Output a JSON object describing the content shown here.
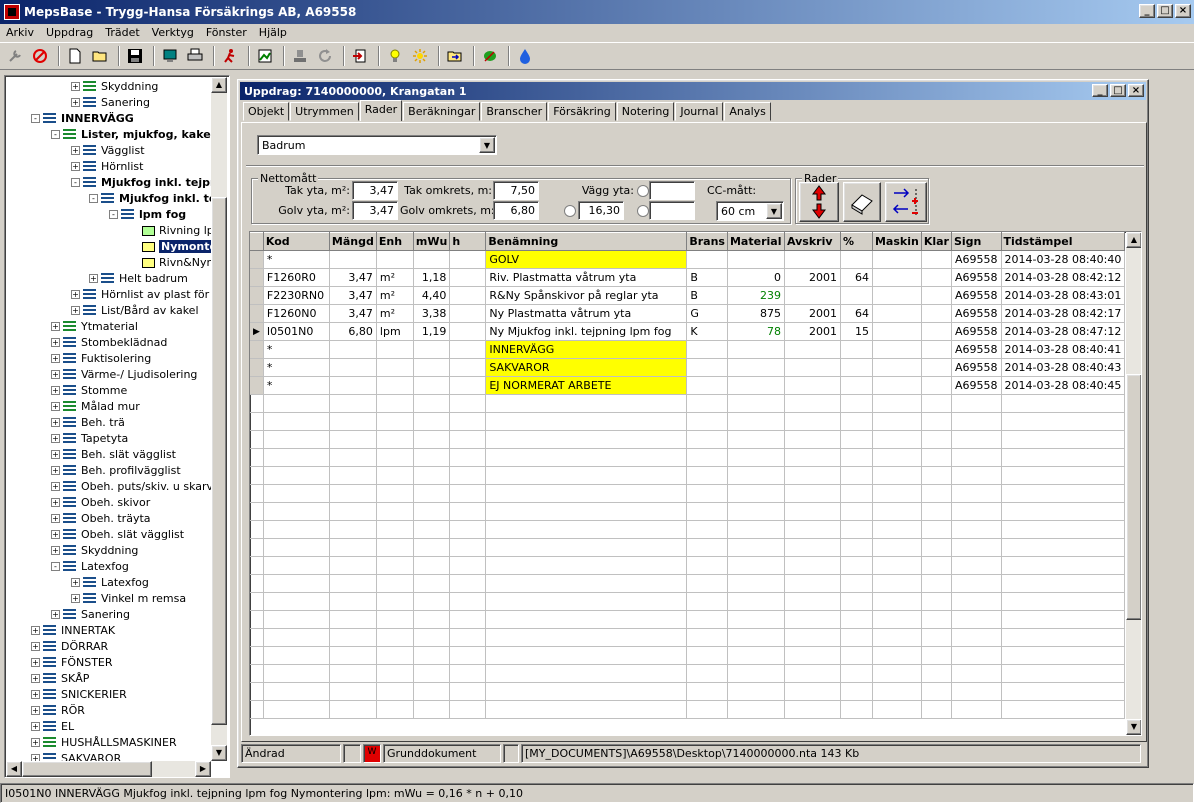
{
  "app": {
    "title": "MepsBase - Trygg-Hansa Försäkrings AB, A69558",
    "window_buttons": [
      "_",
      "□",
      "×"
    ]
  },
  "menu": [
    "Arkiv",
    "Uppdrag",
    "Trädet",
    "Verktyg",
    "Fönster",
    "Hjälp"
  ],
  "toolbar": {
    "icons": [
      "wrench-icon",
      "stop-icon",
      "new-document-icon",
      "open-folder-icon",
      "save-icon",
      "monitor-icon",
      "print-icon",
      "run-icon",
      "image-icon",
      "stamp-icon",
      "refresh-icon",
      "export-icon",
      "lightbulb-icon",
      "sun-icon",
      "folder-arrow-icon",
      "leaf-icon",
      "water-drop-icon"
    ]
  },
  "tree": {
    "items": [
      {
        "label": "Skyddning",
        "level": 3,
        "icon": "greenstack",
        "toggle": "+"
      },
      {
        "label": "Sanering",
        "level": 3,
        "icon": "stack",
        "toggle": "+"
      },
      {
        "label": "INNERVÄGG",
        "level": 1,
        "icon": "stack",
        "toggle": "-",
        "bold": true
      },
      {
        "label": "Lister, mjukfog, kakell",
        "level": 2,
        "icon": "greenstack",
        "toggle": "-",
        "bold": true
      },
      {
        "label": "Vägglist",
        "level": 3,
        "icon": "stack",
        "toggle": "+"
      },
      {
        "label": "Hörnlist",
        "level": 3,
        "icon": "stack",
        "toggle": "+"
      },
      {
        "label": "Mjukfog inkl. tejpn",
        "level": 3,
        "icon": "stack",
        "toggle": "-",
        "bold": true
      },
      {
        "label": "Mjukfog inkl. te",
        "level": 4,
        "icon": "stack",
        "toggle": "-",
        "bold": true
      },
      {
        "label": "lpm fog",
        "level": 5,
        "icon": "stack",
        "toggle": "-",
        "bold": true
      },
      {
        "label": "Rivning lp",
        "level": 6,
        "icon": "greenleaf",
        "toggle": ""
      },
      {
        "label": "Nymonte",
        "level": 6,
        "icon": "leaf",
        "toggle": "",
        "selected": true
      },
      {
        "label": "Rivn&Nym",
        "level": 6,
        "icon": "leaf",
        "toggle": ""
      },
      {
        "label": "Helt badrum",
        "level": 4,
        "icon": "stack",
        "toggle": "+"
      },
      {
        "label": "Hörnlist av plast för ka",
        "level": 3,
        "icon": "stack",
        "toggle": "+"
      },
      {
        "label": "List/Bård av kakel",
        "level": 3,
        "icon": "stack",
        "toggle": "+"
      },
      {
        "label": "Ytmaterial",
        "level": 2,
        "icon": "greenstack",
        "toggle": "+"
      },
      {
        "label": "Stombeklädnad",
        "level": 2,
        "icon": "stack",
        "toggle": "+"
      },
      {
        "label": "Fuktisolering",
        "level": 2,
        "icon": "stack",
        "toggle": "+"
      },
      {
        "label": "Värme-/ Ljudisolering",
        "level": 2,
        "icon": "stack",
        "toggle": "+"
      },
      {
        "label": "Stomme",
        "level": 2,
        "icon": "stack",
        "toggle": "+"
      },
      {
        "label": "Målad mur",
        "level": 2,
        "icon": "greenstack",
        "toggle": "+"
      },
      {
        "label": "Beh. trä",
        "level": 2,
        "icon": "stack",
        "toggle": "+"
      },
      {
        "label": "Tapetyta",
        "level": 2,
        "icon": "stack",
        "toggle": "+"
      },
      {
        "label": "Beh. slät vägglist",
        "level": 2,
        "icon": "stack",
        "toggle": "+"
      },
      {
        "label": "Beh. profilvägglist",
        "level": 2,
        "icon": "stack",
        "toggle": "+"
      },
      {
        "label": "Obeh. puts/skiv. u skarvb",
        "level": 2,
        "icon": "stack",
        "toggle": "+"
      },
      {
        "label": "Obeh. skivor",
        "level": 2,
        "icon": "stack",
        "toggle": "+"
      },
      {
        "label": "Obeh. träyta",
        "level": 2,
        "icon": "stack",
        "toggle": "+"
      },
      {
        "label": "Obeh. slät vägglist",
        "level": 2,
        "icon": "stack",
        "toggle": "+"
      },
      {
        "label": "Skyddning",
        "level": 2,
        "icon": "stack",
        "toggle": "+"
      },
      {
        "label": "Latexfog",
        "level": 2,
        "icon": "stack",
        "toggle": "-"
      },
      {
        "label": "Latexfog",
        "level": 3,
        "icon": "stack",
        "toggle": "+"
      },
      {
        "label": "Vinkel m remsa",
        "level": 3,
        "icon": "stack",
        "toggle": "+"
      },
      {
        "label": "Sanering",
        "level": 2,
        "icon": "stack",
        "toggle": "+"
      },
      {
        "label": "INNERTAK",
        "level": 1,
        "icon": "stack",
        "toggle": "+"
      },
      {
        "label": "DÖRRAR",
        "level": 1,
        "icon": "stack",
        "toggle": "+"
      },
      {
        "label": "FÖNSTER",
        "level": 1,
        "icon": "stack",
        "toggle": "+"
      },
      {
        "label": "SKÅP",
        "level": 1,
        "icon": "stack",
        "toggle": "+"
      },
      {
        "label": "SNICKERIER",
        "level": 1,
        "icon": "stack",
        "toggle": "+"
      },
      {
        "label": "RÖR",
        "level": 1,
        "icon": "stack",
        "toggle": "+"
      },
      {
        "label": "EL",
        "level": 1,
        "icon": "stack",
        "toggle": "+"
      },
      {
        "label": "HUSHÅLLSMASKINER",
        "level": 1,
        "icon": "greenstack",
        "toggle": "+"
      },
      {
        "label": "SAKVAROR",
        "level": 1,
        "icon": "stack",
        "toggle": "+"
      }
    ]
  },
  "uppdrag": {
    "title": "Uppdrag: 7140000000, Krangatan 1",
    "tabs": [
      "Objekt",
      "Utrymmen",
      "Rader",
      "Beräkningar",
      "Branscher",
      "Försäkring",
      "Notering",
      "Journal",
      "Analys"
    ],
    "active_tab": "Rader",
    "room_select": "Badrum",
    "nettomatt": {
      "label": "Nettomått",
      "tak_yta_label": "Tak yta, m²:",
      "tak_yta": "3,47",
      "golv_yta_label": "Golv yta, m²:",
      "golv_yta": "3,47",
      "tak_omkrets_label": "Tak omkrets, m:",
      "tak_omkrets": "7,50",
      "golv_omkrets_label": "Golv omkrets, m:",
      "golv_omkrets": "6,80",
      "vagg_yta_label": "Vägg yta:",
      "vagg_value": "16,30",
      "cc_label": "CC-mått:",
      "cc_value": "60 cm"
    },
    "rader_label": "Rader",
    "grid": {
      "columns": [
        "Kod",
        "Mängd",
        "Enh",
        "mWu",
        "h",
        "Benämning",
        "Brans",
        "Material",
        "Avskriv",
        "%",
        "Maskin",
        "Klar",
        "Sign",
        "Tidstämpel"
      ],
      "rows": [
        {
          "ind": "",
          "kod": "*",
          "mangd": "",
          "enh": "",
          "mwu": "",
          "h": "",
          "ben": "GOLV",
          "brans": "",
          "material": "",
          "avskriv": "",
          "pct": "",
          "maskin": "",
          "klar": "",
          "sign": "A69558",
          "tid": "2014-03-28 08:40:40",
          "yellow": true
        },
        {
          "ind": "",
          "kod": "F1260R0",
          "mangd": "3,47",
          "enh": "m²",
          "mwu": "1,18",
          "h": "",
          "ben": "Riv.  Plastmatta våtrum yta",
          "brans": "B",
          "material": "0",
          "avskriv": "2001",
          "pct": "64",
          "maskin": "",
          "klar": "",
          "sign": "A69558",
          "tid": "2014-03-28 08:42:12"
        },
        {
          "ind": "",
          "kod": "F2230RN0",
          "mangd": "3,47",
          "enh": "m²",
          "mwu": "4,40",
          "h": "",
          "ben": "R&Ny  Spånskivor på reglar yta",
          "brans": "B",
          "material": "239",
          "avskriv": "",
          "pct": "",
          "maskin": "",
          "klar": "",
          "sign": "A69558",
          "tid": "2014-03-28 08:43:01",
          "green": true
        },
        {
          "ind": "",
          "kod": "F1260N0",
          "mangd": "3,47",
          "enh": "m²",
          "mwu": "3,38",
          "h": "",
          "ben": "Ny  Plastmatta våtrum yta",
          "brans": "G",
          "material": "875",
          "avskriv": "2001",
          "pct": "64",
          "maskin": "",
          "klar": "",
          "sign": "A69558",
          "tid": "2014-03-28 08:42:17"
        },
        {
          "ind": "▶",
          "kod": "I0501N0",
          "mangd": "6,80",
          "enh": "lpm",
          "mwu": "1,19",
          "h": "",
          "ben": "Ny  Mjukfog inkl. tejpning lpm fog",
          "brans": "K",
          "material": "78",
          "avskriv": "2001",
          "pct": "15",
          "maskin": "",
          "klar": "",
          "sign": "A69558",
          "tid": "2014-03-28 08:47:12",
          "green": true
        },
        {
          "ind": "",
          "kod": "*",
          "mangd": "",
          "enh": "",
          "mwu": "",
          "h": "",
          "ben": "INNERVÄGG",
          "brans": "",
          "material": "",
          "avskriv": "",
          "pct": "",
          "maskin": "",
          "klar": "",
          "sign": "A69558",
          "tid": "2014-03-28 08:40:41",
          "yellow": true
        },
        {
          "ind": "",
          "kod": "*",
          "mangd": "",
          "enh": "",
          "mwu": "",
          "h": "",
          "ben": "SAKVAROR",
          "brans": "",
          "material": "",
          "avskriv": "",
          "pct": "",
          "maskin": "",
          "klar": "",
          "sign": "A69558",
          "tid": "2014-03-28 08:40:43",
          "yellow": true
        },
        {
          "ind": "",
          "kod": "*",
          "mangd": "",
          "enh": "",
          "mwu": "",
          "h": "",
          "ben": "EJ NORMERAT ARBETE",
          "brans": "",
          "material": "",
          "avskriv": "",
          "pct": "",
          "maskin": "",
          "klar": "",
          "sign": "A69558",
          "tid": "2014-03-28 08:40:45",
          "yellow": true
        }
      ]
    },
    "status": {
      "andrad": "Ändrad",
      "w": "W",
      "grunddokument": "Grunddokument",
      "path": "[MY_DOCUMENTS]\\A69558\\Desktop\\7140000000.nta  143 Kb"
    }
  },
  "statusbar": "I0501N0  INNERVÄGG Mjukfog inkl. tejpning lpm fog Nymontering lpm: mWu = 0,16 * n + 0,10",
  "colors": {
    "title_start": "#0a246a",
    "title_end": "#a6caf0",
    "yellow": "#ffff00",
    "selection": "#0a246a",
    "face": "#d4d0c8"
  }
}
